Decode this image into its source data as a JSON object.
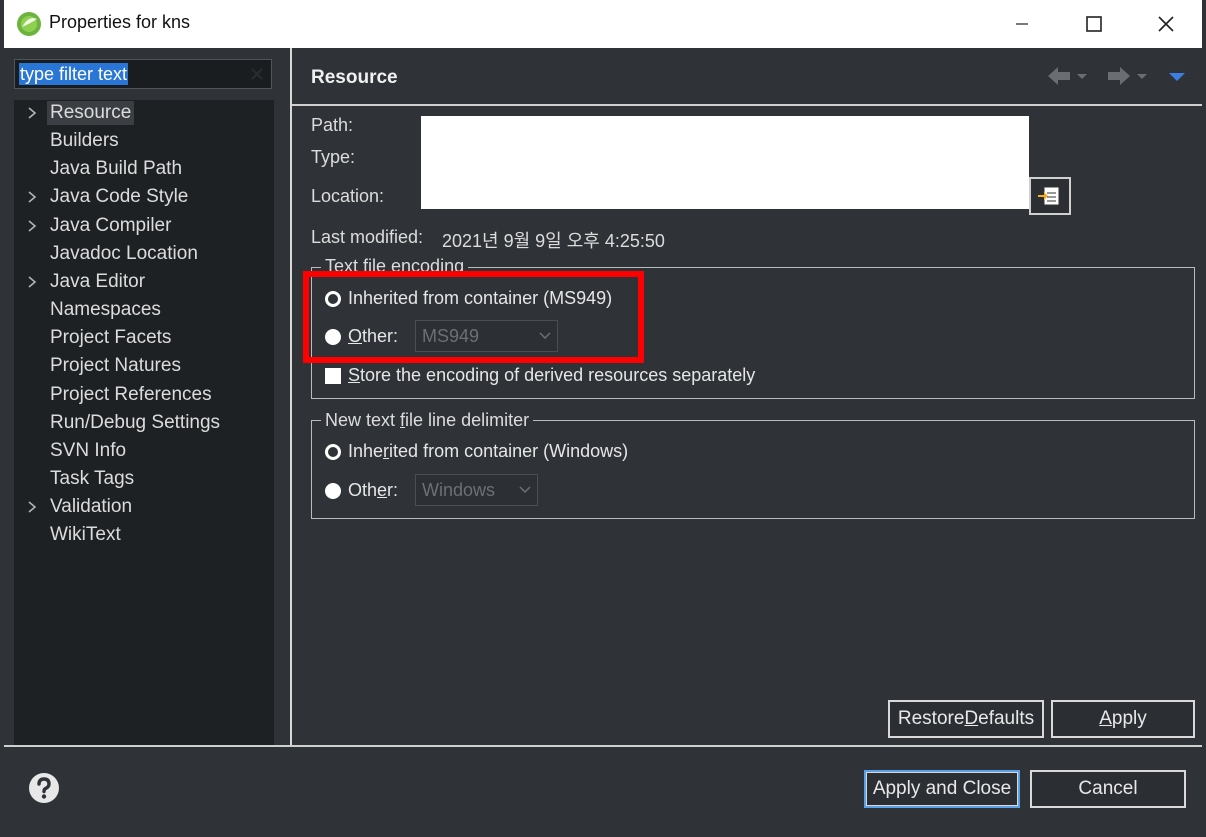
{
  "window": {
    "title": "Properties for kns"
  },
  "filter": {
    "placeholder": "type filter text"
  },
  "tree": {
    "items": [
      {
        "label": "Resource",
        "expandable": true,
        "selected": true
      },
      {
        "label": "Builders",
        "expandable": false
      },
      {
        "label": "Java Build Path",
        "expandable": false
      },
      {
        "label": "Java Code Style",
        "expandable": true
      },
      {
        "label": "Java Compiler",
        "expandable": true
      },
      {
        "label": "Javadoc Location",
        "expandable": false
      },
      {
        "label": "Java Editor",
        "expandable": true
      },
      {
        "label": "Namespaces",
        "expandable": false
      },
      {
        "label": "Project Facets",
        "expandable": false
      },
      {
        "label": "Project Natures",
        "expandable": false
      },
      {
        "label": "Project References",
        "expandable": false
      },
      {
        "label": "Run/Debug Settings",
        "expandable": false
      },
      {
        "label": "SVN Info",
        "expandable": false
      },
      {
        "label": "Task Tags",
        "expandable": false
      },
      {
        "label": "Validation",
        "expandable": true
      },
      {
        "label": "WikiText",
        "expandable": false
      }
    ]
  },
  "page": {
    "title": "Resource",
    "path_label": "Path:",
    "type_label": "Type:",
    "location_label": "Location:",
    "last_modified_label": "Last modified:",
    "last_modified_value": "2021년 9월 9일 오후 4:25:50"
  },
  "encoding": {
    "legend": "Text file encoding",
    "inherited_label": "Inherited from container (MS949)",
    "other_label_pre": "",
    "other_label_u": "O",
    "other_label_post": "ther:",
    "other_value": "MS949",
    "store_label_u": "S",
    "store_label_post": "tore the encoding of derived resources separately"
  },
  "delimiter": {
    "legend_pre": "New text ",
    "legend_u": "f",
    "legend_post": "ile line delimiter",
    "inherited_pre": "Inhe",
    "inherited_u": "r",
    "inherited_post": "ited from container (Windows)",
    "other_pre": "Oth",
    "other_u": "e",
    "other_post": "r:",
    "other_value": "Windows"
  },
  "buttons": {
    "restore_pre": "Restore ",
    "restore_u": "D",
    "restore_post": "efaults",
    "apply_u": "A",
    "apply_post": "pply",
    "apply_close": "Apply and Close",
    "cancel": "Cancel"
  },
  "colors": {
    "background": "#2f3337",
    "tree_background": "#1e2124",
    "selection": "#2a76d6",
    "highlight": "#ff0000",
    "nav_accent": "#3d7fe0"
  }
}
